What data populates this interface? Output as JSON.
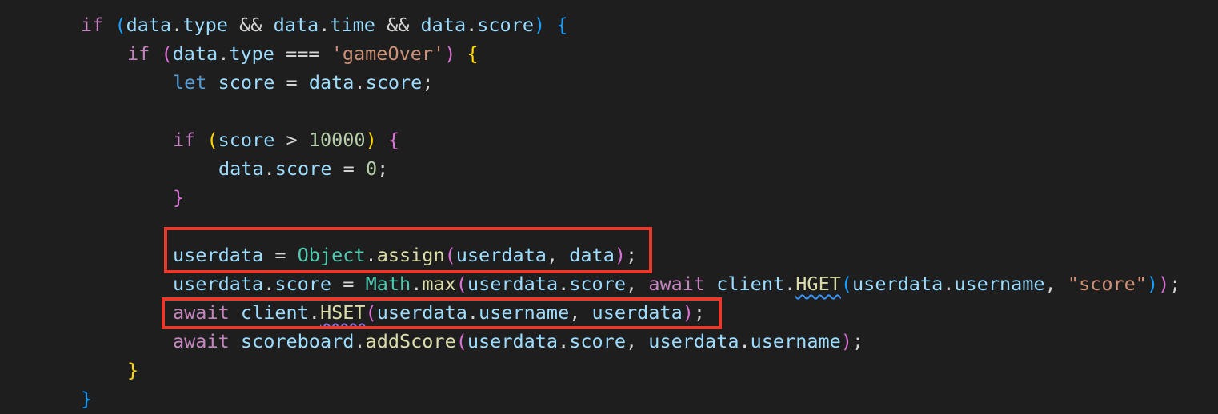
{
  "code_lines": [
    {
      "tokens": [
        "if",
        "(",
        "data",
        ".",
        "type",
        "&&",
        "data",
        ".",
        "time",
        "&&",
        "data",
        ".",
        "score",
        ")",
        "{"
      ]
    },
    {
      "tokens": [
        "if",
        "(",
        "data",
        ".",
        "type",
        "===",
        "'gameOver'",
        ")",
        "{"
      ]
    },
    {
      "tokens": [
        "let",
        "score",
        "=",
        "data",
        ".",
        "score",
        ";"
      ]
    },
    {
      "tokens": []
    },
    {
      "tokens": [
        "if",
        "(",
        "score",
        ">",
        "10000",
        ")",
        "{"
      ]
    },
    {
      "tokens": [
        "data",
        ".",
        "score",
        "=",
        "0",
        ";"
      ]
    },
    {
      "tokens": [
        "}"
      ]
    },
    {
      "tokens": []
    },
    {
      "tokens": [
        "userdata",
        "=",
        "Object",
        ".",
        "assign",
        "(",
        "userdata",
        ",",
        "data",
        ")",
        ";"
      ]
    },
    {
      "tokens": [
        "userdata",
        ".",
        "score",
        "=",
        "Math",
        ".",
        "max",
        "(",
        "userdata",
        ".",
        "score",
        ",",
        "await",
        "client",
        ".",
        "HGET",
        "(",
        "userdata",
        ".",
        "username",
        ",",
        "\"score\"",
        ")",
        ")",
        ";"
      ]
    },
    {
      "tokens": [
        "await",
        "client",
        ".",
        "HSET",
        "(",
        "userdata",
        ".",
        "username",
        ",",
        "userdata",
        ")",
        ";"
      ]
    },
    {
      "tokens": [
        "await",
        "scoreboard",
        ".",
        "addScore",
        "(",
        "userdata",
        ".",
        "score",
        ",",
        "userdata",
        ".",
        "username",
        ")",
        ";"
      ]
    },
    {
      "tokens": [
        "}"
      ]
    },
    {
      "tokens": [
        "}"
      ]
    }
  ],
  "colors": {
    "background": "#1e1e1e",
    "keyword_control": "#c586c0",
    "keyword_storage": "#569cd6",
    "variable": "#9cdcfe",
    "function": "#dcdcaa",
    "string": "#ce9178",
    "number": "#b5cea8",
    "class": "#4ec9b0",
    "highlight_box": "#e8392e"
  }
}
